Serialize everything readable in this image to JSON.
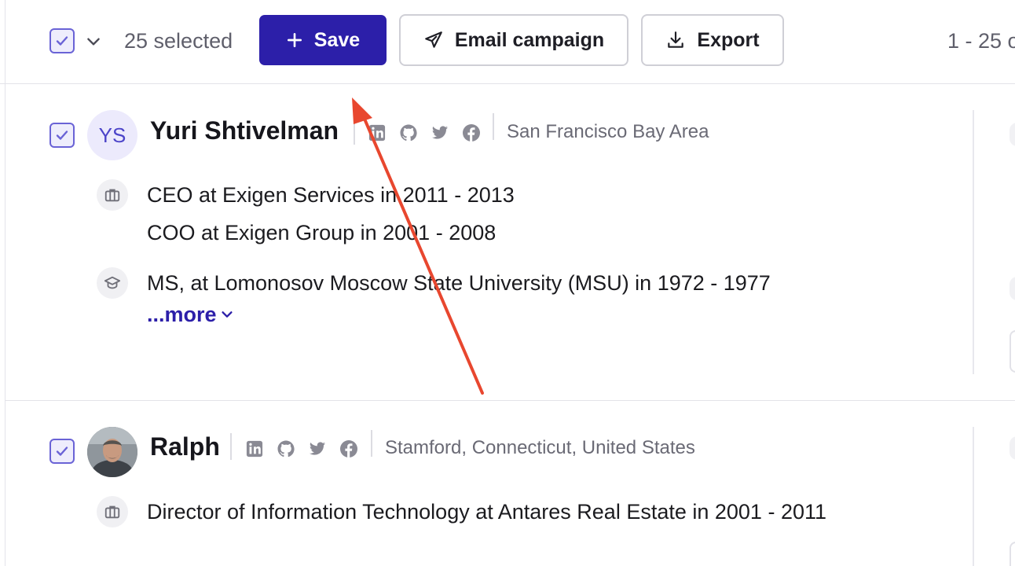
{
  "toolbar": {
    "selected_text": "25 selected",
    "save_label": "Save",
    "email_label": "Email campaign",
    "export_label": "Export",
    "pager_text": "1 - 25 o"
  },
  "people": [
    {
      "initials": "YS",
      "name": "Yuri Shtivelman",
      "location": "San Francisco Bay Area",
      "jobs": [
        "CEO at Exigen Services in 2011 - 2013",
        "COO at Exigen Group in 2001 - 2008"
      ],
      "education": [
        "MS, at Lomonosov Moscow State University (MSU) in 1972 - 1977"
      ],
      "more_label": "...more"
    },
    {
      "name": "Ralph",
      "location": "Stamford, Connecticut, United States",
      "jobs": [
        "Director of Information Technology at Antares Real Estate in 2001 - 2011"
      ]
    }
  ],
  "colors": {
    "primary": "#2c1fa9",
    "checkbox": "#6a63d6",
    "annotation_arrow": "#e8472f"
  },
  "icons": [
    "checkbox-check-icon",
    "chevron-down-icon",
    "plus-icon",
    "send-icon",
    "download-icon",
    "linkedin-icon",
    "github-icon",
    "twitter-icon",
    "facebook-icon",
    "briefcase-icon",
    "graduation-cap-icon"
  ]
}
